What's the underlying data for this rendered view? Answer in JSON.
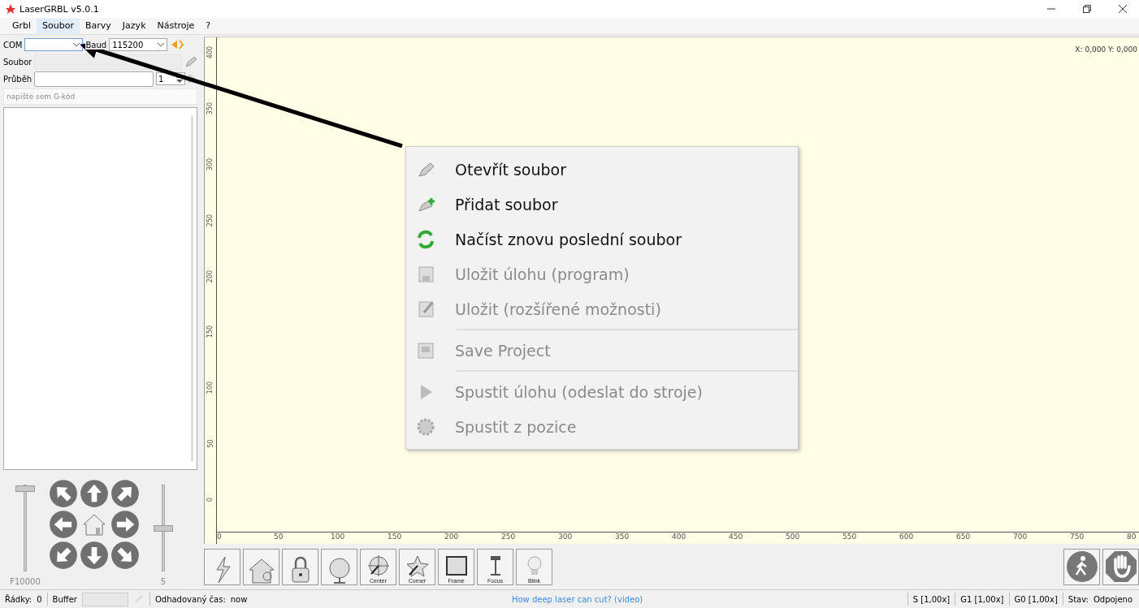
{
  "window": {
    "title": "LaserGRBL v5.0.1"
  },
  "menu": [
    {
      "label": "Grbl",
      "selected": false
    },
    {
      "label": "Soubor",
      "selected": true
    },
    {
      "label": "Barvy",
      "selected": false
    },
    {
      "label": "Jazyk",
      "selected": false
    },
    {
      "label": "Nástroje",
      "selected": false
    },
    {
      "label": "?",
      "selected": false
    }
  ],
  "connection": {
    "port_label": "COM",
    "baud_label": "Baud",
    "baud": "115200"
  },
  "file": {
    "label": "Soubor"
  },
  "progress": {
    "label": "Průběh",
    "level": 0,
    "passes": "1"
  },
  "gcode": {
    "placeholder": "napište sem G-kód"
  },
  "jog": {
    "feed_slider": {
      "level": 0.95
    },
    "feed": "F10000",
    "step_slider": {
      "level": 0.5
    },
    "step": "5"
  },
  "canvas": {
    "coords": "X: 0,000 Y: 0,000",
    "y_labels": [
      "400",
      "350",
      "300",
      "250",
      "200",
      "150",
      "100",
      "50",
      "0"
    ],
    "x_labels": [
      "0",
      "50",
      "100",
      "150",
      "200",
      "250",
      "300",
      "350",
      "400",
      "450",
      "500",
      "550",
      "600",
      "650",
      "700",
      "750",
      "80"
    ]
  },
  "context_menu": [
    {
      "kind": "item",
      "label": "Otevřít soubor",
      "disabled": false
    },
    {
      "kind": "item",
      "label": "Přidat soubor",
      "disabled": false
    },
    {
      "kind": "item",
      "label": "Načíst znovu poslední soubor",
      "disabled": false
    },
    {
      "kind": "item",
      "label": "Uložit úlohu (program)",
      "disabled": true
    },
    {
      "kind": "item",
      "label": "Uložit (rozšířené možnosti)",
      "disabled": true
    },
    {
      "kind": "separator"
    },
    {
      "kind": "item",
      "label": "Save Project",
      "disabled": true
    },
    {
      "kind": "separator"
    },
    {
      "kind": "item",
      "label": "Spustit úlohu (odeslat do stroje)",
      "disabled": true
    },
    {
      "kind": "item",
      "label": "Spustit z pozice",
      "disabled": true
    }
  ],
  "toolbar": [
    {
      "kind": "plain"
    },
    {
      "kind": "plain"
    },
    {
      "kind": "plain"
    },
    {
      "kind": "plain"
    },
    {
      "kind": "labeled",
      "label": "Center"
    },
    {
      "kind": "labeled",
      "label": "Corner"
    },
    {
      "kind": "labeled",
      "label": "Frame"
    },
    {
      "kind": "labeled",
      "label": "Focus"
    },
    {
      "kind": "labeled",
      "label": "Blink"
    }
  ],
  "status_bar": {
    "lines_label": "Řádky:",
    "lines": "0",
    "buffer_label": "Buffer",
    "time_label": "Odhadovaný čas:",
    "time": "now",
    "link": "How deep laser can cut? (video)",
    "overrides": [
      "S [1,00x]",
      "G1 [1,00x]",
      "G0 [1,00x]"
    ],
    "state_label": "Stav:",
    "state": "Odpojeno"
  }
}
